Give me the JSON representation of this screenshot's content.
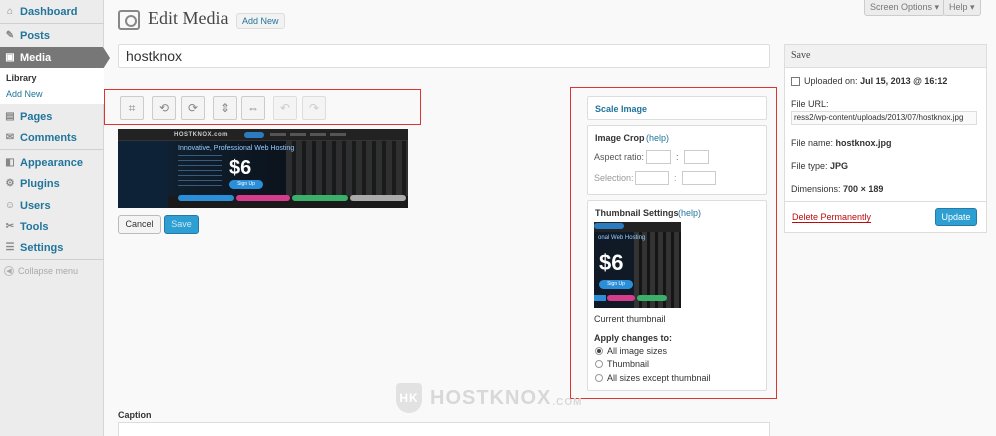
{
  "sidebar": {
    "items": [
      {
        "label": "Dashboard",
        "icon": "dashboard-icon",
        "glyph": "⌂"
      },
      {
        "label": "Posts",
        "icon": "pushpin-icon",
        "glyph": "✎"
      },
      {
        "label": "Media",
        "icon": "media-icon",
        "glyph": "▣"
      },
      {
        "label": "Pages",
        "icon": "pages-icon",
        "glyph": "▤"
      },
      {
        "label": "Comments",
        "icon": "comment-icon",
        "glyph": "✉"
      },
      {
        "label": "Appearance",
        "icon": "appearance-icon",
        "glyph": "◧"
      },
      {
        "label": "Plugins",
        "icon": "plugin-icon",
        "glyph": "⚙"
      },
      {
        "label": "Users",
        "icon": "users-icon",
        "glyph": "☺"
      },
      {
        "label": "Tools",
        "icon": "tools-icon",
        "glyph": "✂"
      },
      {
        "label": "Settings",
        "icon": "settings-icon",
        "glyph": "☰"
      }
    ],
    "submenu": {
      "library": "Library",
      "add_new": "Add New"
    },
    "collapse": "Collapse menu"
  },
  "header": {
    "title": "Edit Media",
    "add_new": "Add New",
    "screen_options": "Screen Options ▾",
    "help": "Help ▾"
  },
  "title_field": {
    "value": "hostknox"
  },
  "toolbar": {
    "buttons": [
      "crop-icon",
      "rotate-left-icon",
      "rotate-right-icon",
      "flip-vertical-icon",
      "flip-horizontal-icon",
      "undo-icon",
      "redo-icon"
    ]
  },
  "preview": {
    "logo": "HOSTKNOX.com",
    "headline": "Innovative, Professional Web Hosting",
    "price": "$6",
    "signup": "Sign Up"
  },
  "editor_buttons": {
    "cancel": "Cancel",
    "save": "Save"
  },
  "scale": {
    "title": "Scale Image"
  },
  "crop": {
    "title": "Image Crop",
    "help": "(help)",
    "aspect_ratio": "Aspect ratio:",
    "selection": "Selection:",
    "separator": ":"
  },
  "thumbnail": {
    "title": "Thumbnail Settings",
    "help": "(help)",
    "current": "Current thumbnail",
    "price": "$6",
    "headline": "onal Web Hosting",
    "signup": "Sign Up",
    "apply_label": "Apply changes to:",
    "options": [
      {
        "label": "All image sizes",
        "checked": true
      },
      {
        "label": "Thumbnail",
        "checked": false
      },
      {
        "label": "All sizes except thumbnail",
        "checked": false
      }
    ]
  },
  "save_box": {
    "title": "Save",
    "uploaded_label": "Uploaded on:",
    "uploaded_value": "Jul 15, 2013 @ 16:12",
    "file_url_label": "File URL:",
    "file_url_value": "ress2/wp-content/uploads/2013/07/hostknox.jpg",
    "file_name_label": "File name:",
    "file_name_value": "hostknox.jpg",
    "file_type_label": "File type:",
    "file_type_value": "JPG",
    "dimensions_label": "Dimensions:",
    "dimensions_value": "700 × 189",
    "delete": "Delete Permanently",
    "update": "Update"
  },
  "caption": {
    "label": "Caption"
  },
  "watermark": {
    "text": "HOSTKNOX",
    "suffix": ".COM",
    "emblem": "HK"
  },
  "colors": {
    "accent": "#21759b",
    "button_blue": "#2e9fd2",
    "highlight_border": "#dd3333",
    "delete": "#bc0b0b"
  }
}
